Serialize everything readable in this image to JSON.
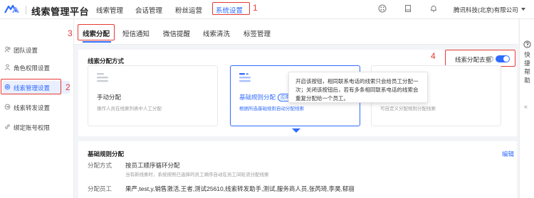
{
  "header": {
    "app_title": "线索管理平台",
    "nav": [
      "线索管理",
      "会话管理",
      "粉丝运营",
      "系统设置"
    ],
    "active_nav": "系统设置",
    "company": "腾讯科技(北京)有限公司",
    "icons": [
      "grid-app-icon",
      "document-icon",
      "bell-icon"
    ]
  },
  "annotations": {
    "n1": "1",
    "n2": "2",
    "n3": "3",
    "n4": "4"
  },
  "sidebar": {
    "items": [
      {
        "label": "团队设置",
        "icon": "team-icon"
      },
      {
        "label": "角色权限设置",
        "icon": "role-icon"
      },
      {
        "label": "线索管理设置",
        "icon": "settings-icon",
        "active": true
      },
      {
        "label": "线索转发设置",
        "icon": "forward-icon"
      },
      {
        "label": "绑定账号权限",
        "icon": "link-icon"
      }
    ]
  },
  "tabs": [
    "线索分配",
    "短信通知",
    "微信提醒",
    "线索清洗",
    "标签管理"
  ],
  "right_rail": {
    "label": "快捷帮助",
    "collapse": "«"
  },
  "assignment": {
    "section_title": "线索分配方式",
    "dedupe_label": "线索分配去重",
    "dedupe_help": "?",
    "dedupe_enabled": true,
    "cards": [
      {
        "name": "手动分配",
        "desc": "操作人员在线索列表中人工分配"
      },
      {
        "name": "基础规则分配",
        "badge": "应用",
        "desc": "根据所选基础规则自动分配线索",
        "selected": true
      },
      {
        "name": "",
        "desc": "可自定义分配规则分配线索"
      }
    ],
    "tooltip": "开启该按钮，相同联系电话的线索只会给员工分配一次；关闭该按钮后，若有多条相同联系电话的线索会重复分配给一个员工。"
  },
  "basic_rules": {
    "title": "基础规则分配",
    "edit": "编辑",
    "method_label": "分配方式",
    "method_value": "按员工顺序循环分配",
    "method_sub": "当有新线索时，系统按照已选择的员工顺序自动在员工间轮流分配线索",
    "staff_label": "分配员工",
    "staff_value": "果严,test,y,销售激活,王者,测试25610,线索转发助手,测试,服务商人员,张芮琦,李昊,郁丽"
  },
  "colors": {
    "accent": "#2f6bff",
    "annotation": "#e53935"
  }
}
